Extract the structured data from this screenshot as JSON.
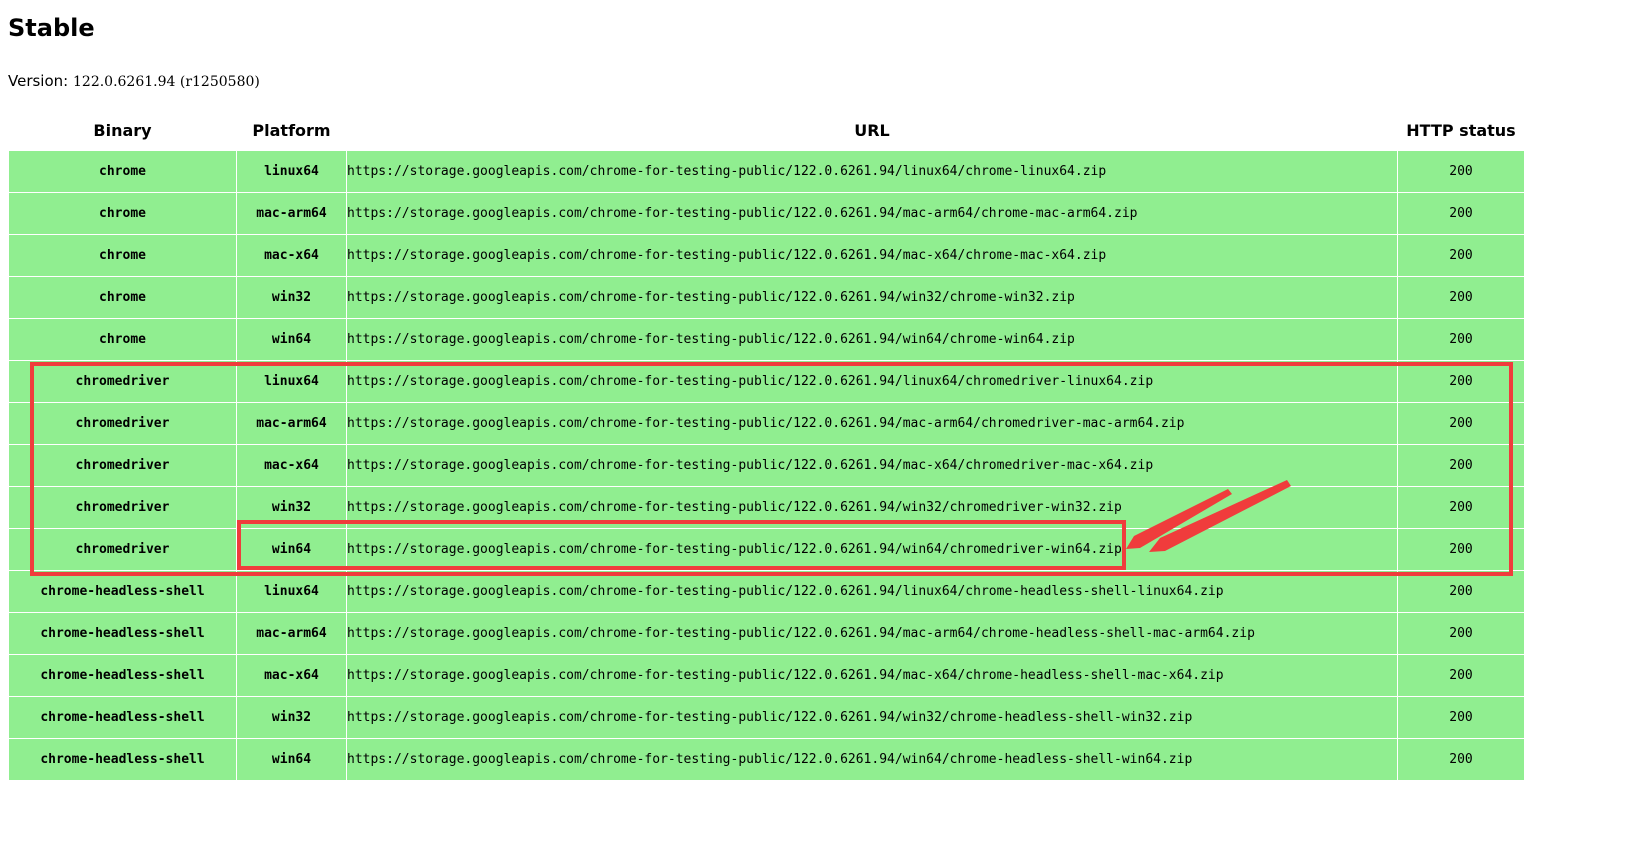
{
  "page": {
    "title": "Stable",
    "version_label": "Version:",
    "version_value": "122.0.6261.94 (r1250580)"
  },
  "table": {
    "headers": {
      "binary": "Binary",
      "platform": "Platform",
      "url": "URL",
      "status": "HTTP status"
    },
    "rows": [
      {
        "binary": "chrome",
        "platform": "linux64",
        "url": "https://storage.googleapis.com/chrome-for-testing-public/122.0.6261.94/linux64/chrome-linux64.zip",
        "status": "200"
      },
      {
        "binary": "chrome",
        "platform": "mac-arm64",
        "url": "https://storage.googleapis.com/chrome-for-testing-public/122.0.6261.94/mac-arm64/chrome-mac-arm64.zip",
        "status": "200"
      },
      {
        "binary": "chrome",
        "platform": "mac-x64",
        "url": "https://storage.googleapis.com/chrome-for-testing-public/122.0.6261.94/mac-x64/chrome-mac-x64.zip",
        "status": "200"
      },
      {
        "binary": "chrome",
        "platform": "win32",
        "url": "https://storage.googleapis.com/chrome-for-testing-public/122.0.6261.94/win32/chrome-win32.zip",
        "status": "200"
      },
      {
        "binary": "chrome",
        "platform": "win64",
        "url": "https://storage.googleapis.com/chrome-for-testing-public/122.0.6261.94/win64/chrome-win64.zip",
        "status": "200"
      },
      {
        "binary": "chromedriver",
        "platform": "linux64",
        "url": "https://storage.googleapis.com/chrome-for-testing-public/122.0.6261.94/linux64/chromedriver-linux64.zip",
        "status": "200"
      },
      {
        "binary": "chromedriver",
        "platform": "mac-arm64",
        "url": "https://storage.googleapis.com/chrome-for-testing-public/122.0.6261.94/mac-arm64/chromedriver-mac-arm64.zip",
        "status": "200"
      },
      {
        "binary": "chromedriver",
        "platform": "mac-x64",
        "url": "https://storage.googleapis.com/chrome-for-testing-public/122.0.6261.94/mac-x64/chromedriver-mac-x64.zip",
        "status": "200"
      },
      {
        "binary": "chromedriver",
        "platform": "win32",
        "url": "https://storage.googleapis.com/chrome-for-testing-public/122.0.6261.94/win32/chromedriver-win32.zip",
        "status": "200"
      },
      {
        "binary": "chromedriver",
        "platform": "win64",
        "url": "https://storage.googleapis.com/chrome-for-testing-public/122.0.6261.94/win64/chromedriver-win64.zip",
        "status": "200"
      },
      {
        "binary": "chrome-headless-shell",
        "platform": "linux64",
        "url": "https://storage.googleapis.com/chrome-for-testing-public/122.0.6261.94/linux64/chrome-headless-shell-linux64.zip",
        "status": "200"
      },
      {
        "binary": "chrome-headless-shell",
        "platform": "mac-arm64",
        "url": "https://storage.googleapis.com/chrome-for-testing-public/122.0.6261.94/mac-arm64/chrome-headless-shell-mac-arm64.zip",
        "status": "200"
      },
      {
        "binary": "chrome-headless-shell",
        "platform": "mac-x64",
        "url": "https://storage.googleapis.com/chrome-for-testing-public/122.0.6261.94/mac-x64/chrome-headless-shell-mac-x64.zip",
        "status": "200"
      },
      {
        "binary": "chrome-headless-shell",
        "platform": "win32",
        "url": "https://storage.googleapis.com/chrome-for-testing-public/122.0.6261.94/win32/chrome-headless-shell-win32.zip",
        "status": "200"
      },
      {
        "binary": "chrome-headless-shell",
        "platform": "win64",
        "url": "https://storage.googleapis.com/chrome-for-testing-public/122.0.6261.94/win64/chrome-headless-shell-win64.zip",
        "status": "200"
      }
    ]
  },
  "colors": {
    "row_background": "#90ee90",
    "annotation": "#f03c3c"
  }
}
